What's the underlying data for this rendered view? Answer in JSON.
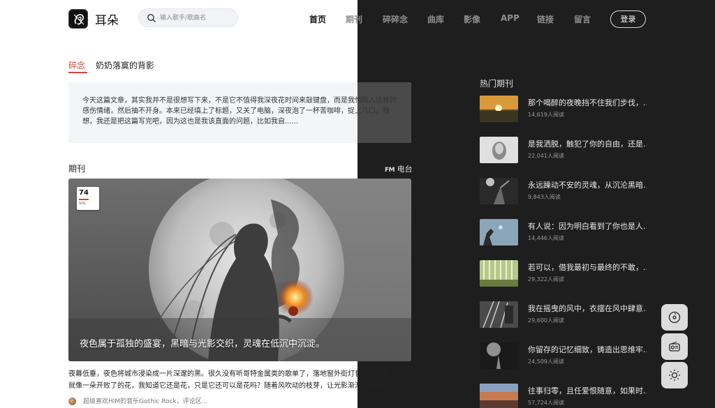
{
  "header": {
    "logo_text": "耳朵",
    "search_placeholder": "输入歌手/歌曲名",
    "nav": [
      "首页",
      "期刊",
      "碎碎念",
      "曲库",
      "影像",
      "APP",
      "链接",
      "留言"
    ],
    "login_label": "登录"
  },
  "essay": {
    "tag": "碎念",
    "title": "奶奶落寞的背影",
    "text": "今天这篇文章，其实我并不是很想写下来，不是它不值得我深夜花时间来敲键盘，而是我怕陷入这样的感伤情绪，然后抽不开身。本来已经填上了标题，又关了电脑，深夜泡了一杯苦咖啡，捉上几口，我想，我还是把这篇写完吧，因为这也是我该直面的问题，比如我自......"
  },
  "journal": {
    "heading": "期刊",
    "fm_mark": "FM",
    "fm_label": "电台",
    "vol_number": "74",
    "vol_label": "VOL.",
    "caption": "夜色属于孤独的盛宴，黑暗与光影交织，灵魂在低沉中沉淀。",
    "summary_line1": "夜幕低垂，夜色将城市浸染成一片深邃的黑。很久没有听哥特金属类的歌单了，落地窗外街灯昏黄的光晕，",
    "summary_line2": "就像一朵开败了的花，我知道它还是花，只是它还可以是花吗？随着风吹动的枝芽，让光影渐渐的迷离，...",
    "comment": "超级喜欢HIM的音乐Gothic Rock，评论区..."
  },
  "hot": {
    "title": "热门期刊",
    "items": [
      {
        "text": "那个喝醉的夜晚挡不住我们步伐，...",
        "reads": "14,619人阅读"
      },
      {
        "text": "是我洒脱，触犯了你的自由，还是...",
        "reads": "22,041人阅读"
      },
      {
        "text": "永远躁动不安的灵魂，从沉沦黑暗...",
        "reads": "9,843人阅读"
      },
      {
        "text": "有人说：因为明白看到了你也是人...",
        "reads": "14,446人阅读"
      },
      {
        "text": "若可以，借我最初与最终的不敢，...",
        "reads": "29,322人阅读"
      },
      {
        "text": "我在摇曳的风中，衣摆在风中肆意...",
        "reads": "29,600人阅读"
      },
      {
        "text": "你留存的记忆细致，铸造出思维牢...",
        "reads": "24,509人阅读"
      },
      {
        "text": "往事归零，且任爱恨随意，如果时...",
        "reads": "57,724人阅读"
      }
    ]
  },
  "side_buttons": [
    "music-disc-icon",
    "radio-icon",
    "sun-theme-icon"
  ]
}
